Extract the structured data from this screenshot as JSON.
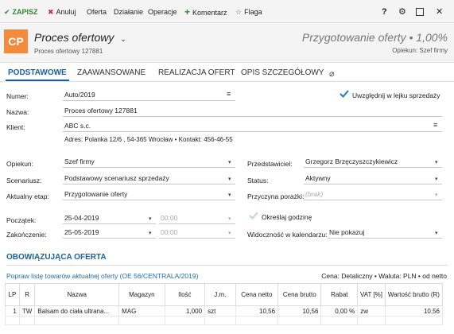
{
  "toolbar": {
    "save": "ZAPISZ",
    "cancel": "Anuluj",
    "offer": "Oferta",
    "action": "Działanie",
    "operations": "Operacje",
    "comment": "Komentarz",
    "flag": "Flaga",
    "help": "?",
    "colors": {
      "save": "#2a8a2a",
      "cancel": "#d12b2b",
      "comment": "#2a8a2a"
    }
  },
  "header": {
    "badge": "CP",
    "title": "Proces ofertowy",
    "subtitle": "Proces ofertowy 127881",
    "stage": "Przygotowanie oferty • 1,00%",
    "opiekun": "Opiekun: Szef firmy",
    "badge_color": "#f58a3c"
  },
  "tabs": [
    "PODSTAWOWE",
    "ZAAWANSOWANE",
    "REALIZACJA OFERT",
    "OPIS SZCZEGÓŁOWY"
  ],
  "form": {
    "numer_label": "Numer:",
    "numer_value": "Auto/2019",
    "lejek_label": "Uwzględnij w lejku sprzedaży",
    "nazwa_label": "Nazwa:",
    "nazwa_value": "Proces ofertowy 127881",
    "klient_label": "Klient:",
    "klient_value": "ABC s.c.",
    "klient_address": "Adres:  Polanka  12/6 , 54-365 Wrocław  •  Kontakt:  456-46-55",
    "opiekun_label": "Opiekun:",
    "opiekun_value": "Szef firmy",
    "przedstawiciel_label": "Przedstawiciel:",
    "przedstawiciel_value": "Grzegorz Brzęczyszczykiewicz",
    "scenariusz_label": "Scenariusz:",
    "scenariusz_value": "Podstawowy scenariusz sprzedaży",
    "status_label": "Status:",
    "status_value": "Aktywny",
    "etap_label": "Aktualny etap:",
    "etap_value": "Przygotowanie oferty",
    "porazka_label": "Przyczyna porażki:",
    "porazka_value": "(brak)",
    "poczatek_label": "Początek:",
    "poczatek_date": "25-04-2019",
    "poczatek_time": "00:00",
    "godzine_label": "Określaj godzinę",
    "zakonczenie_label": "Zakończenie:",
    "zakonczenie_date": "25-05-2019",
    "zakonczenie_time": "00:00",
    "widocznosc_label": "Widoczność w kalendarzu:",
    "widocznosc_value": "Nie pokazuj"
  },
  "offer": {
    "section_title": "OBOWIĄZUJĄCA OFERTA",
    "link": "Popraw listę towarów aktualnej oferty (OE 56/CENTRALA/2019)",
    "info": "Cena: Detaliczny • Waluta: PLN • od netto",
    "columns": [
      "LP",
      "R",
      "Nazwa",
      "Magazyn",
      "Ilość",
      "J.m.",
      "Cena netto",
      "Cena brutto",
      "Rabat",
      "VAT [%]",
      "Wartość brutto (R)"
    ],
    "rows": [
      [
        "1",
        "TW",
        "Balsam do ciała ultrana...",
        "MAG",
        "1,000",
        "szt",
        "10,56",
        "10,56",
        "0,00 %",
        "zw",
        "10,56"
      ]
    ]
  }
}
